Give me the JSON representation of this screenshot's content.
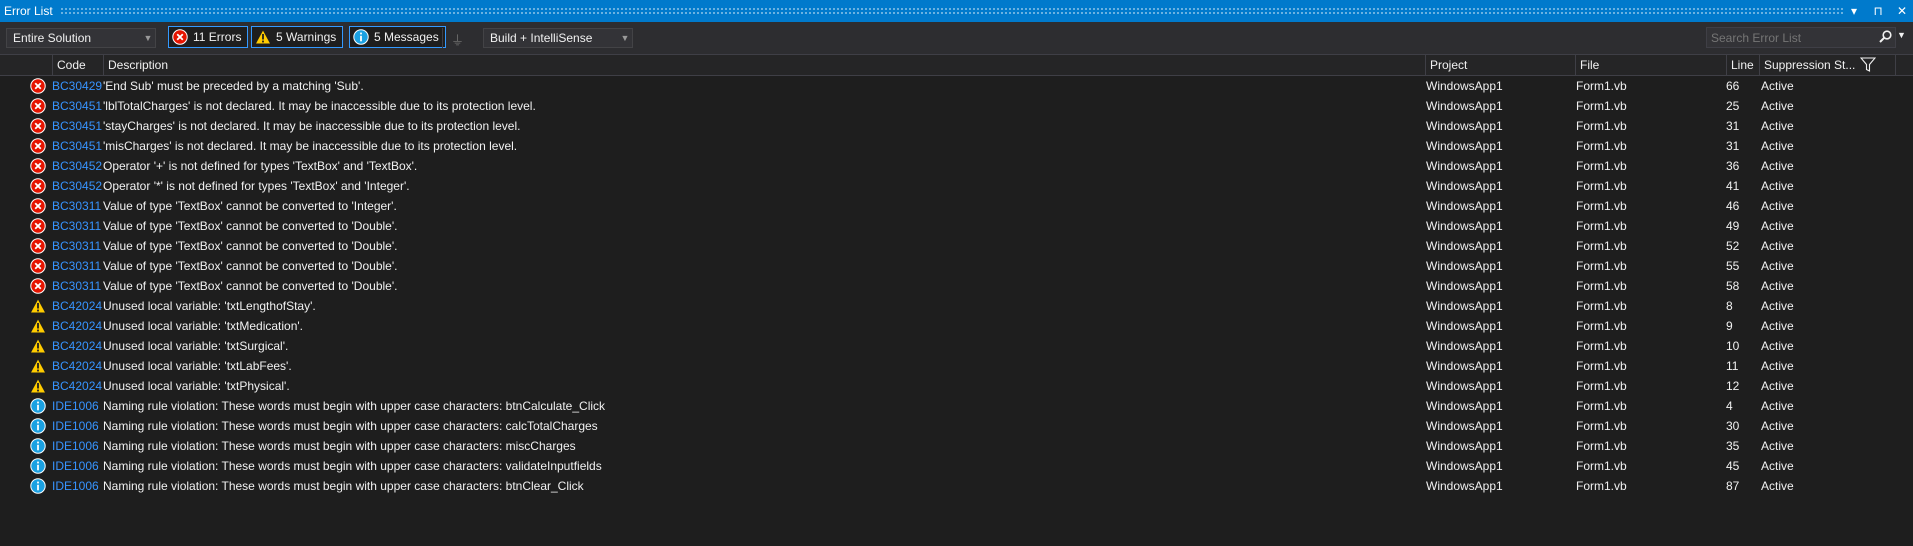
{
  "window": {
    "title": "Error List",
    "controls": [
      "▾",
      "⊓",
      "✕"
    ]
  },
  "toolbar": {
    "scope": "Entire Solution",
    "errors_label": "11 Errors",
    "warnings_label": "5 Warnings",
    "messages_label": "5 Messages",
    "source": "Build + IntelliSense",
    "search_placeholder": "Search Error List"
  },
  "columns": {
    "code": "Code",
    "description": "Description",
    "project": "Project",
    "file": "File",
    "line": "Line",
    "suppression": "Suppression St..."
  },
  "colors": {
    "error": "#e51400",
    "warning": "#ffcc00",
    "info": "#1ba1e2",
    "accent": "#007acc",
    "link": "#3794ff"
  },
  "rows": [
    {
      "type": "error",
      "code": "BC30429",
      "description": "'End Sub' must be preceded by a matching 'Sub'.",
      "project": "WindowsApp1",
      "file": "Form1.vb",
      "line": "66",
      "suppression": "Active"
    },
    {
      "type": "error",
      "code": "BC30451",
      "description": "'lblTotalCharges' is not declared. It may be inaccessible due to its protection level.",
      "project": "WindowsApp1",
      "file": "Form1.vb",
      "line": "25",
      "suppression": "Active"
    },
    {
      "type": "error",
      "code": "BC30451",
      "description": "'stayCharges' is not declared. It may be inaccessible due to its protection level.",
      "project": "WindowsApp1",
      "file": "Form1.vb",
      "line": "31",
      "suppression": "Active"
    },
    {
      "type": "error",
      "code": "BC30451",
      "description": "'misCharges' is not declared. It may be inaccessible due to its protection level.",
      "project": "WindowsApp1",
      "file": "Form1.vb",
      "line": "31",
      "suppression": "Active"
    },
    {
      "type": "error",
      "code": "BC30452",
      "description": "Operator '+' is not defined for types 'TextBox' and 'TextBox'.",
      "project": "WindowsApp1",
      "file": "Form1.vb",
      "line": "36",
      "suppression": "Active"
    },
    {
      "type": "error",
      "code": "BC30452",
      "description": "Operator '*' is not defined for types 'TextBox' and 'Integer'.",
      "project": "WindowsApp1",
      "file": "Form1.vb",
      "line": "41",
      "suppression": "Active"
    },
    {
      "type": "error",
      "code": "BC30311",
      "description": "Value of type 'TextBox' cannot be converted to 'Integer'.",
      "project": "WindowsApp1",
      "file": "Form1.vb",
      "line": "46",
      "suppression": "Active"
    },
    {
      "type": "error",
      "code": "BC30311",
      "description": "Value of type 'TextBox' cannot be converted to 'Double'.",
      "project": "WindowsApp1",
      "file": "Form1.vb",
      "line": "49",
      "suppression": "Active"
    },
    {
      "type": "error",
      "code": "BC30311",
      "description": "Value of type 'TextBox' cannot be converted to 'Double'.",
      "project": "WindowsApp1",
      "file": "Form1.vb",
      "line": "52",
      "suppression": "Active"
    },
    {
      "type": "error",
      "code": "BC30311",
      "description": "Value of type 'TextBox' cannot be converted to 'Double'.",
      "project": "WindowsApp1",
      "file": "Form1.vb",
      "line": "55",
      "suppression": "Active"
    },
    {
      "type": "error",
      "code": "BC30311",
      "description": "Value of type 'TextBox' cannot be converted to 'Double'.",
      "project": "WindowsApp1",
      "file": "Form1.vb",
      "line": "58",
      "suppression": "Active"
    },
    {
      "type": "warning",
      "code": "BC42024",
      "description": "Unused local variable: 'txtLengthofStay'.",
      "project": "WindowsApp1",
      "file": "Form1.vb",
      "line": "8",
      "suppression": "Active"
    },
    {
      "type": "warning",
      "code": "BC42024",
      "description": "Unused local variable: 'txtMedication'.",
      "project": "WindowsApp1",
      "file": "Form1.vb",
      "line": "9",
      "suppression": "Active"
    },
    {
      "type": "warning",
      "code": "BC42024",
      "description": "Unused local variable: 'txtSurgical'.",
      "project": "WindowsApp1",
      "file": "Form1.vb",
      "line": "10",
      "suppression": "Active"
    },
    {
      "type": "warning",
      "code": "BC42024",
      "description": "Unused local variable: 'txtLabFees'.",
      "project": "WindowsApp1",
      "file": "Form1.vb",
      "line": "11",
      "suppression": "Active"
    },
    {
      "type": "warning",
      "code": "BC42024",
      "description": "Unused local variable: 'txtPhysical'.",
      "project": "WindowsApp1",
      "file": "Form1.vb",
      "line": "12",
      "suppression": "Active"
    },
    {
      "type": "info",
      "code": "IDE1006",
      "description": "Naming rule violation: These words must begin with upper case characters: btnCalculate_Click",
      "project": "WindowsApp1",
      "file": "Form1.vb",
      "line": "4",
      "suppression": "Active"
    },
    {
      "type": "info",
      "code": "IDE1006",
      "description": "Naming rule violation: These words must begin with upper case characters: calcTotalCharges",
      "project": "WindowsApp1",
      "file": "Form1.vb",
      "line": "30",
      "suppression": "Active"
    },
    {
      "type": "info",
      "code": "IDE1006",
      "description": "Naming rule violation: These words must begin with upper case characters: miscCharges",
      "project": "WindowsApp1",
      "file": "Form1.vb",
      "line": "35",
      "suppression": "Active"
    },
    {
      "type": "info",
      "code": "IDE1006",
      "description": "Naming rule violation: These words must begin with upper case characters: validateInputfields",
      "project": "WindowsApp1",
      "file": "Form1.vb",
      "line": "45",
      "suppression": "Active"
    },
    {
      "type": "info",
      "code": "IDE1006",
      "description": "Naming rule violation: These words must begin with upper case characters: btnClear_Click",
      "project": "WindowsApp1",
      "file": "Form1.vb",
      "line": "87",
      "suppression": "Active"
    }
  ]
}
